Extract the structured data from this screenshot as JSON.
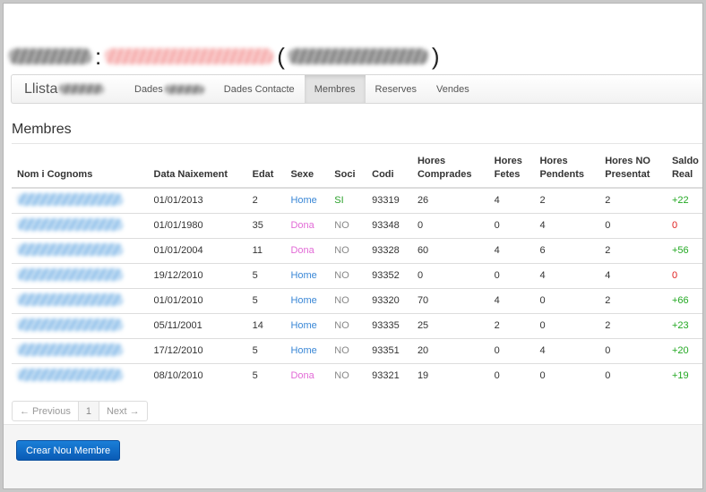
{
  "nav": {
    "brand_prefix": "Llista",
    "items": [
      {
        "label": "Dades",
        "active": false
      },
      {
        "label": "Dades Contacte",
        "active": false
      },
      {
        "label": "Membres",
        "active": true
      },
      {
        "label": "Reserves",
        "active": false
      },
      {
        "label": "Vendes",
        "active": false
      }
    ]
  },
  "title": {
    "sep1": ":",
    "open": "(",
    "close": ")"
  },
  "section_heading": "Membres",
  "table": {
    "headers": {
      "name": "Nom i Cognoms",
      "birth": "Data Naixement",
      "age": "Edat",
      "sex": "Sexe",
      "member": "Soci",
      "code": "Codi",
      "bought": "Hores Comprades",
      "done": "Hores Fetes",
      "pending": "Hores Pendents",
      "no_show": "Hores NO Presentat",
      "balance": "Saldo Real"
    },
    "rows": [
      {
        "birth": "01/01/2013",
        "age": "2",
        "sex": "Home",
        "member": "SI",
        "code": "93319",
        "bought": "26",
        "done": "4",
        "pending": "2",
        "no_show": "2",
        "balance": "+22"
      },
      {
        "birth": "01/01/1980",
        "age": "35",
        "sex": "Dona",
        "member": "NO",
        "code": "93348",
        "bought": "0",
        "done": "0",
        "pending": "4",
        "no_show": "0",
        "balance": "0"
      },
      {
        "birth": "01/01/2004",
        "age": "11",
        "sex": "Dona",
        "member": "NO",
        "code": "93328",
        "bought": "60",
        "done": "4",
        "pending": "6",
        "no_show": "2",
        "balance": "+56"
      },
      {
        "birth": "19/12/2010",
        "age": "5",
        "sex": "Home",
        "member": "NO",
        "code": "93352",
        "bought": "0",
        "done": "0",
        "pending": "4",
        "no_show": "4",
        "balance": "0"
      },
      {
        "birth": "01/01/2010",
        "age": "5",
        "sex": "Home",
        "member": "NO",
        "code": "93320",
        "bought": "70",
        "done": "4",
        "pending": "0",
        "no_show": "2",
        "balance": "+66"
      },
      {
        "birth": "05/11/2001",
        "age": "14",
        "sex": "Home",
        "member": "NO",
        "code": "93335",
        "bought": "25",
        "done": "2",
        "pending": "0",
        "no_show": "2",
        "balance": "+23"
      },
      {
        "birth": "17/12/2010",
        "age": "5",
        "sex": "Home",
        "member": "NO",
        "code": "93351",
        "bought": "20",
        "done": "0",
        "pending": "4",
        "no_show": "0",
        "balance": "+20"
      },
      {
        "birth": "08/10/2010",
        "age": "5",
        "sex": "Dona",
        "member": "NO",
        "code": "93321",
        "bought": "19",
        "done": "0",
        "pending": "0",
        "no_show": "0",
        "balance": "+19"
      }
    ]
  },
  "pagination": {
    "previous": "← Previous",
    "page": "1",
    "next": "Next →"
  },
  "footer": {
    "create_label": "Crear Nou Membre"
  },
  "colors": {
    "home": "#3a87d6",
    "dona": "#e26ad6",
    "si": "#2aa02a",
    "no": "#888888",
    "positive": "#22a822",
    "zero": "#e02020",
    "primary_button": "#0a5bb5"
  }
}
